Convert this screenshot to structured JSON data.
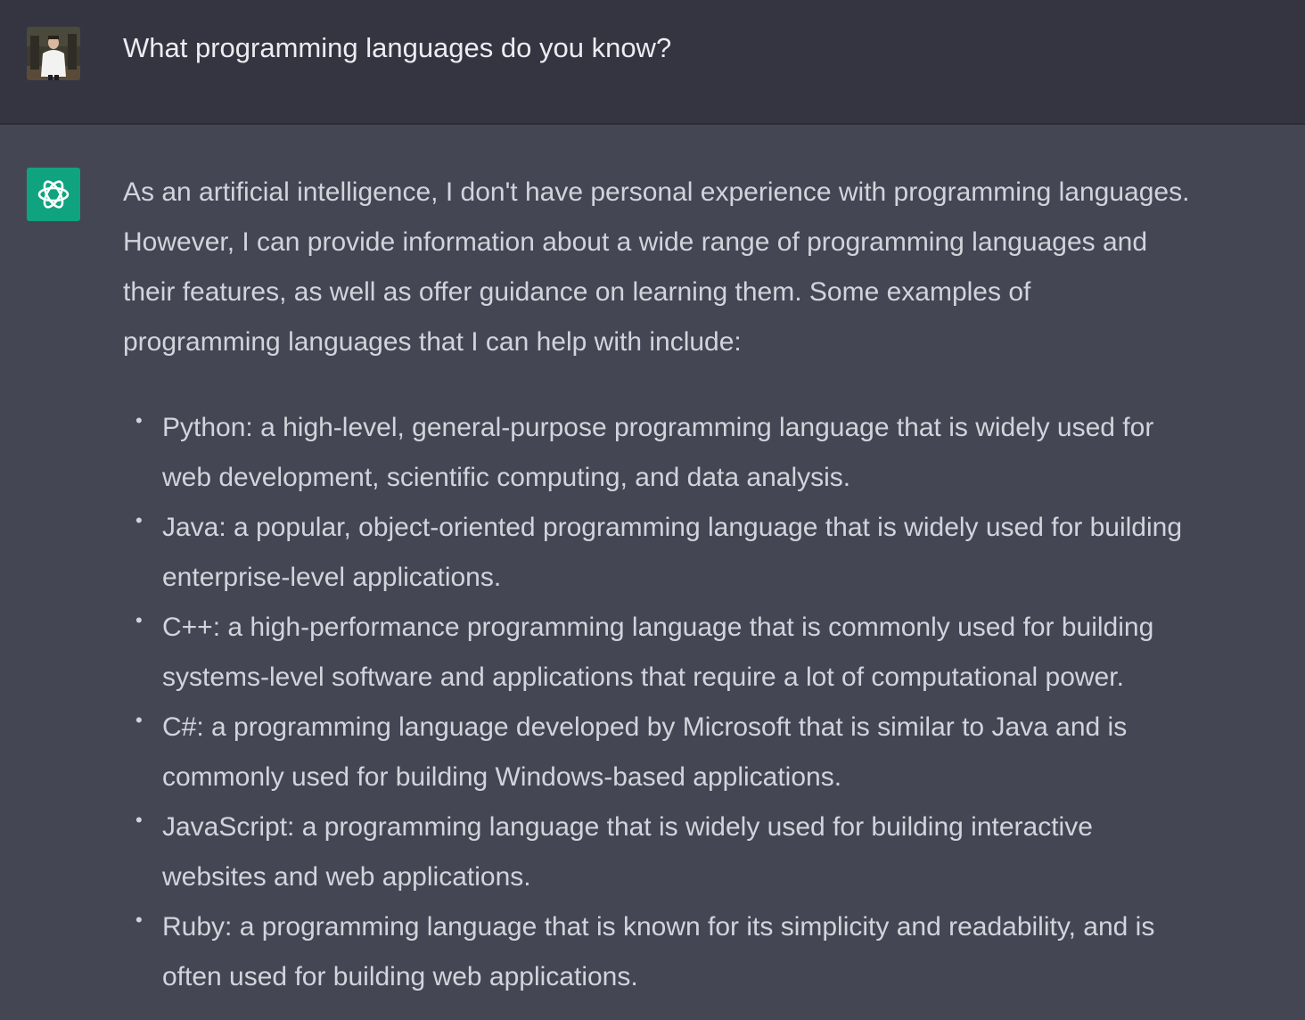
{
  "user_message": {
    "text": "What programming languages do you know?"
  },
  "assistant_message": {
    "intro_lines": [
      "As an artificial intelligence, I don't have personal experience with programming languages.",
      "However, I can provide information about a wide range of programming languages and",
      "their features, as well as offer guidance on learning them. Some examples of",
      "programming languages that I can help with include:"
    ],
    "bullet_glyph": "•",
    "list": [
      {
        "lines": [
          "Python: a high-level, general-purpose programming language that is widely used for",
          "web development, scientific computing, and data analysis."
        ]
      },
      {
        "lines": [
          "Java: a popular, object-oriented programming language that is widely used for building",
          "enterprise-level applications."
        ]
      },
      {
        "lines": [
          "C++: a high-performance programming language that is commonly used for building",
          "systems-level software and applications that require a lot of computational power."
        ]
      },
      {
        "lines": [
          "C#: a programming language developed by Microsoft that is similar to Java and is",
          "commonly used for building Windows-based applications."
        ]
      },
      {
        "lines": [
          "JavaScript: a programming language that is widely used for building interactive",
          "websites and web applications."
        ]
      },
      {
        "lines": [
          "Ruby: a programming language that is known for its simplicity and readability, and is",
          "often used for building web applications."
        ]
      }
    ]
  },
  "icons": {
    "user_avatar": "user-avatar-photo",
    "assistant_avatar": "openai-logo-icon"
  },
  "colors": {
    "user_row_bg": "#343541",
    "assistant_row_bg": "#444654",
    "assistant_avatar_bg": "#10a37f",
    "user_text": "#ececf1",
    "assistant_text": "#d1d5db"
  }
}
